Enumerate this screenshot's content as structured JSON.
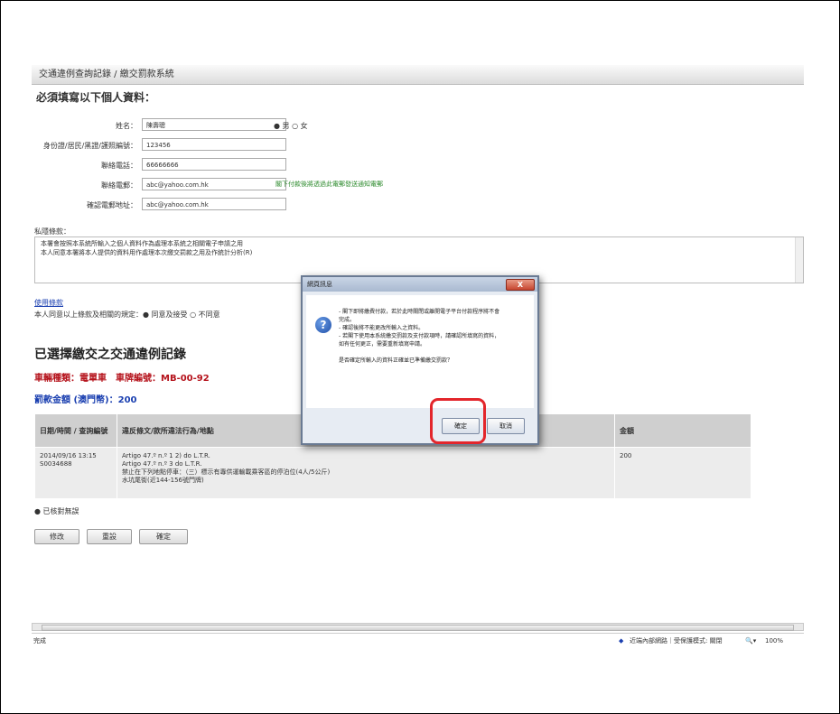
{
  "header": {
    "title": "交通違例查詢記錄 / 繳交罰款系統",
    "subtitle": "必須填寫以下個人資料："
  },
  "form": {
    "fields": [
      {
        "label": "姓名：",
        "value": "陳壽聰"
      },
      {
        "label": "身份證/居民/黑證/護照編號：",
        "value": "123456"
      },
      {
        "label": "聯絡電話：",
        "value": "66666666"
      },
      {
        "label": "聯絡電郵：",
        "value": "abc@yahoo.com.hk"
      },
      {
        "label": "確認電郵地址：",
        "value": "abc@yahoo.com.hk"
      }
    ],
    "gender": "● 男 ○ 女",
    "email_hint": "閣下付款後將透過此電郵發送通知電郵"
  },
  "privacy": {
    "title": "私隱條款：",
    "line1": "本署會按照本系統所輸入之個人資料作為處理本系統之相關電子申請之用",
    "line2": "本人同意本署將本人提供的資料用作處理本次繳交罰款之用及作統計分析(R)"
  },
  "terms_link": "使用條款",
  "agree_text": "本人同意以上條款及相關的規定：● 同意及接受 ○ 不同意",
  "records": {
    "title": "已選擇繳交之交通違例記錄",
    "plate_info": "車輛種類：電單車　車牌編號：MB-00-92",
    "amount": "罰款金額 (澳門幣)：200",
    "columns": [
      "日期/時間 / 查詢編號",
      "違反條文/款所違法行為/地點",
      "金額"
    ],
    "rows": [
      {
        "datetime": "2014/09/16 13:15",
        "id": "S0034688",
        "desc1": "Artigo 47.º n.º 1 2) do L.T.R.",
        "desc2": "Artigo 47.º n.º 3 do L.T.R.",
        "desc3": "禁止在下列地點停車：（三）標示有專供運輸載乘客區的停泊位(4人/5公斤)",
        "desc4": "水坑尾街(近144-156號門牌)",
        "amount": "200"
      }
    ]
  },
  "selected_label": "● 已核對無誤",
  "buttons": [
    "修改",
    "重設",
    "確定"
  ],
  "statusbar": {
    "left": "完成",
    "zone": "近端內部網路｜受保護模式: 關閉",
    "zoom": "100%"
  },
  "dialog": {
    "title": "網頁訊息",
    "close": "X",
    "icon": "?",
    "lines": [
      "- 閣下即將繳費付款，若於此時關閉或離開電子平台付款程序將不會",
      "  完成。",
      "- 確認後將不能更改所輸入之資料。",
      "- 若閣下使用本系統繳交罰款及支付款項時，請確認所填寫的資料，",
      "  如有任何更正，需要重新填寫申請。",
      "",
      "是否確定所輸入的資料正確並已準備繳交罰款？"
    ],
    "ok": "確定",
    "cancel": "取消"
  },
  "colors": {
    "highlight": "#e3262b",
    "plate": "#b5121b",
    "link": "#1a3fb0",
    "hint": "#2e8b2e"
  }
}
